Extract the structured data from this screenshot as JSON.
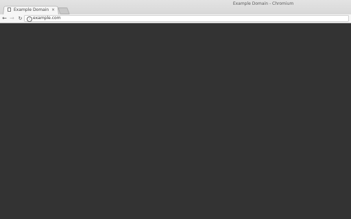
{
  "window": {
    "title": "Example Domain - Chromium"
  },
  "tabs": [
    {
      "title": "Example Domain",
      "close_glyph": "×",
      "icon": "page-icon"
    }
  ],
  "toolbar": {
    "back_glyph": "←",
    "forward_glyph": "→",
    "reload_glyph": "↻",
    "info_glyph": "i",
    "url": "example.com"
  },
  "colors": {
    "page_background": "#333333",
    "chrome_background": "#f6f6f6",
    "titlebar": "#dedede"
  }
}
